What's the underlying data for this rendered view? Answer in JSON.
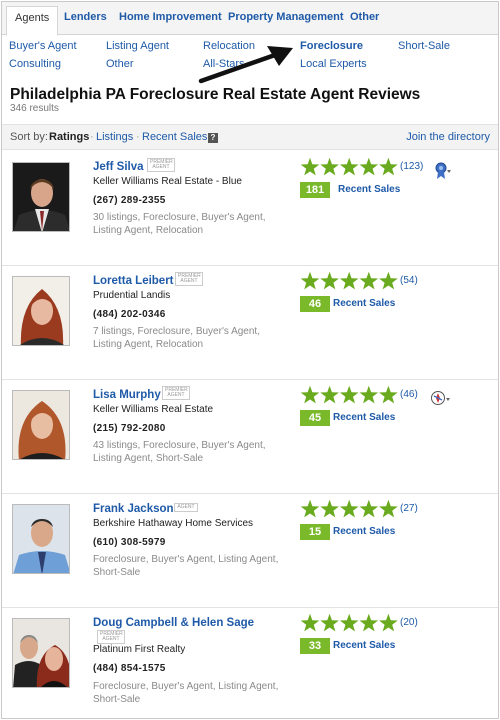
{
  "tabs": [
    "Agents",
    "Lenders",
    "Home Improvement",
    "Property Management",
    "Other"
  ],
  "subnav": [
    {
      "label": "Buyer's Agent"
    },
    {
      "label": "Listing Agent"
    },
    {
      "label": "Relocation"
    },
    {
      "label": "Foreclosure"
    },
    {
      "label": "Short-Sale"
    },
    {
      "label": "Consulting"
    },
    {
      "label": "Other"
    },
    {
      "label": "All-Stars"
    },
    {
      "label": "Local Experts"
    }
  ],
  "page": {
    "title": "Philadelphia PA Foreclosure Real Estate Agent Reviews",
    "count": "346 results"
  },
  "sort": {
    "label": "Sort by:",
    "ratings": "Ratings",
    "listings": "Listings",
    "recent": "Recent Sales",
    "dot": "·",
    "help": "?",
    "join": "Join the directory"
  },
  "badge_text": {
    "premier": "PREMIER AGENT",
    "agent": "AGENT"
  },
  "sales_label": "Recent Sales",
  "agents": [
    {
      "name": "Jeff Silva",
      "company": "Keller Williams Real Estate - Blue",
      "phone": "(267) 289-2355",
      "desc": "30 listings, Foreclosure, Buyer's Agent, Listing Agent, Relocation",
      "rating": 5,
      "reviews": "(123)",
      "sales": "181",
      "award": "ribbon-award-icon"
    },
    {
      "name": "Loretta Leibert",
      "company": "Prudential Landis",
      "phone": "(484) 202-0346",
      "desc": "7 listings, Foreclosure, Buyer's Agent, Listing Agent, Relocation",
      "rating": 5,
      "reviews": "(54)",
      "sales": "46"
    },
    {
      "name": "Lisa Murphy",
      "company": "Keller Williams Real Estate",
      "phone": "(215) 792-2080",
      "desc": "43 listings, Foreclosure, Buyer's Agent, Listing Agent, Short-Sale",
      "rating": 5,
      "reviews": "(46)",
      "sales": "45",
      "award": "compass-award-icon"
    },
    {
      "name": "Frank Jackson",
      "company": "Berkshire Hathaway Home Services",
      "phone": "(610) 308-5979",
      "desc": "Foreclosure, Buyer's Agent, Listing Agent, Short-Sale",
      "rating": 5,
      "reviews": "(27)",
      "sales": "15"
    },
    {
      "name": "Doug Campbell & Helen Sage",
      "company": "Platinum First Realty",
      "phone": "(484) 854-1575",
      "desc": "Foreclosure, Buyer's Agent, Listing Agent, Short-Sale",
      "rating": 5,
      "reviews": "(20)",
      "sales": "33"
    }
  ],
  "colors": {
    "link": "#1e5aa8",
    "star": "#6aaa1e",
    "sales_badge": "#7ab929"
  }
}
